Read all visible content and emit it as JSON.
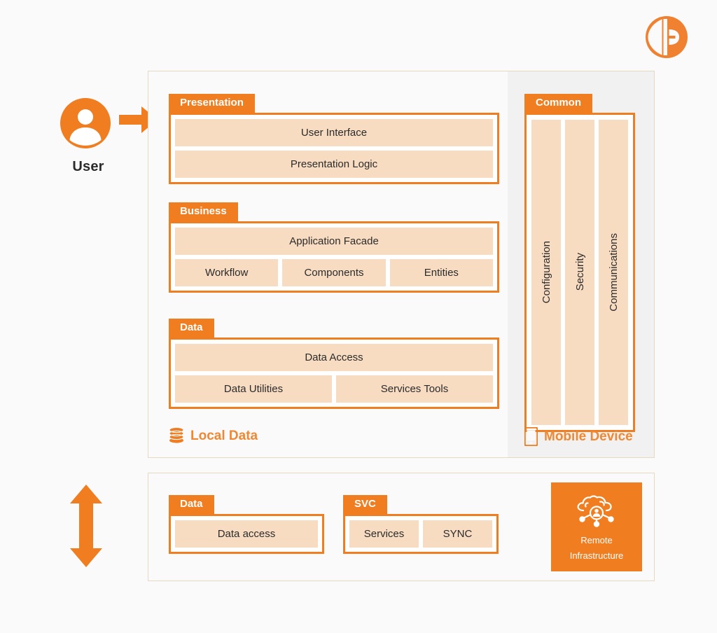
{
  "colors": {
    "accent": "#f07d20",
    "accent_light": "#ef8833",
    "cell_fill": "#f8dcc2",
    "panel_border": "#e6d8c3",
    "panel_bg": "#fbfafa",
    "shaded_column": "#f1f1f1",
    "page_bg": "#fafafa",
    "text_dark": "#2b2b2b",
    "white": "#ffffff"
  },
  "logo": {
    "icon": "circular-b-logo-icon",
    "alt": "company-logo"
  },
  "actor": {
    "icon": "user-avatar-icon",
    "label": "User",
    "arrow_icon": "right-arrow-icon"
  },
  "sync": {
    "arrow_icon": "vertical-double-arrow-icon"
  },
  "device_panel": {
    "caption": {
      "icon": "database-icon",
      "label": "Local Data"
    },
    "mobile_caption": {
      "icon": "mobile-phone-icon",
      "label": "Mobile Device"
    },
    "tiers": [
      {
        "id": "presentation",
        "tab": "Presentation",
        "rows": [
          [
            "User Interface"
          ],
          [
            "Presentation Logic"
          ]
        ]
      },
      {
        "id": "business",
        "tab": "Business",
        "rows": [
          [
            "Application Facade"
          ],
          [
            "Workflow",
            "Components",
            "Entities"
          ]
        ]
      },
      {
        "id": "data",
        "tab": "Data",
        "rows": [
          [
            "Data Access"
          ],
          [
            "Data Utilities",
            "Services Tools"
          ]
        ]
      }
    ],
    "common": {
      "tab": "Common",
      "items": [
        "Configuration",
        "Security",
        "Communications"
      ]
    }
  },
  "remote_panel": {
    "tiers": [
      {
        "id": "remote-data",
        "tab": "Data",
        "rows": [
          [
            "Data access"
          ]
        ]
      },
      {
        "id": "svc",
        "tab": "SVC",
        "rows": [
          [
            "Services",
            "SYNC"
          ]
        ]
      }
    ],
    "infrastructure": {
      "icon": "cloud-user-network-icon",
      "line1": "Remote",
      "line2": "Infrastructure"
    }
  }
}
